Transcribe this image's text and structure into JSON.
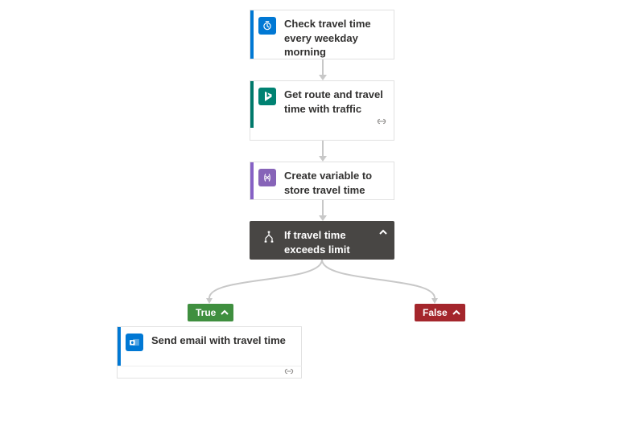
{
  "steps": {
    "trigger": {
      "label": "Check travel time every weekday morning",
      "accent": "#0078d4",
      "iconbg": "#0078d4"
    },
    "route": {
      "label": "Get route and travel time with traffic",
      "accent": "#00796b",
      "iconbg": "#008272"
    },
    "variable": {
      "label": "Create variable to store travel time",
      "accent": "#8661c5",
      "iconbg": "#8764b8"
    },
    "condition": {
      "label": "If travel time exceeds limit"
    }
  },
  "branches": {
    "true": {
      "label": "True",
      "color": "#3f8f3f"
    },
    "false": {
      "label": "False",
      "color": "#a4262c"
    }
  },
  "trueAction": {
    "label": "Send email with travel time",
    "accent": "#0078d4",
    "iconbg": "#0078d4"
  }
}
